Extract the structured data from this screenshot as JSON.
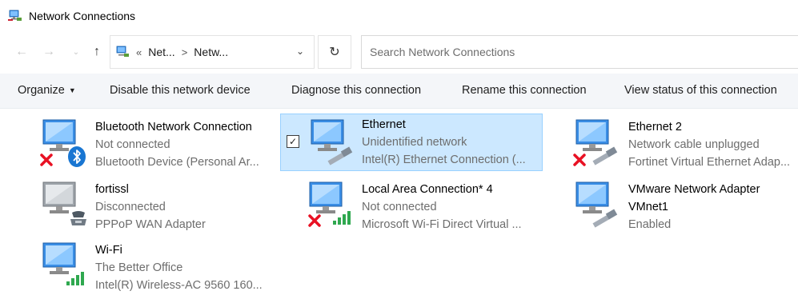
{
  "window": {
    "title": "Network Connections"
  },
  "address": {
    "prefix": "«",
    "crumbs": [
      "Net...",
      "Netw..."
    ],
    "separator": ">"
  },
  "search": {
    "placeholder": "Search Network Connections"
  },
  "commands": {
    "organize": "Organize",
    "disable": "Disable this network device",
    "diagnose": "Diagnose this connection",
    "rename": "Rename this connection",
    "view_status": "View status of this connection"
  },
  "connections": [
    {
      "name": "Bluetooth Network Connection",
      "status": "Not connected",
      "device": "Bluetooth Device (Personal Ar...",
      "badge": "bluetooth-icon",
      "error": true
    },
    {
      "name": "Ethernet",
      "status": "Unidentified network",
      "device": "Intel(R) Ethernet Connection (...",
      "badge": "cable-icon",
      "error": false,
      "selected": true
    },
    {
      "name": "Ethernet 2",
      "status": "Network cable unplugged",
      "device": "Fortinet Virtual Ethernet Adap...",
      "badge": "cable-icon",
      "error": true
    },
    {
      "name": "fortissl",
      "status": "Disconnected",
      "device": "PPPoP WAN Adapter",
      "badge": "modem-icon",
      "error": false
    },
    {
      "name": "Local Area Connection* 4",
      "status": "Not connected",
      "device": "Microsoft Wi-Fi Direct Virtual ...",
      "badge": "wifi-signal-icon",
      "error": true
    },
    {
      "name": "VMware Network Adapter",
      "name2": "VMnet1",
      "status": "Enabled",
      "badge": "cable-icon",
      "error": false
    },
    {
      "name": "Wi-Fi",
      "status": "The Better Office",
      "device": "Intel(R) Wireless-AC 9560 160...",
      "badge": "wifi-signal-icon",
      "error": false
    }
  ],
  "colors": {
    "selection_bg": "#cce8ff",
    "selection_border": "#99d1ff",
    "command_bar_bg": "#f4f6f9",
    "secondary_text": "#6d6d6d",
    "error_red": "#e81123",
    "signal_green": "#2fa84f",
    "bluetooth_blue": "#1976d2"
  }
}
